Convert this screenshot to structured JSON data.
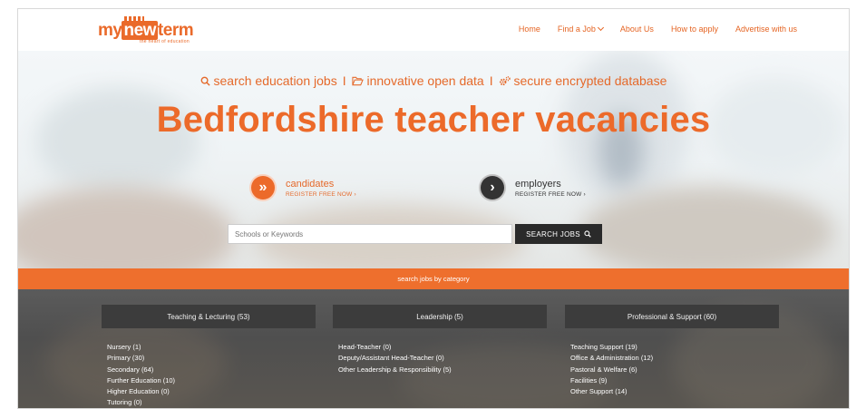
{
  "header": {
    "logo": {
      "my": "my",
      "new": "new",
      "term": "term",
      "tagline": "the heart of education"
    },
    "nav": [
      {
        "label": "Home"
      },
      {
        "label": "Find a Job"
      },
      {
        "label": "About Us"
      },
      {
        "label": "How to apply"
      },
      {
        "label": "Advertise with us"
      }
    ]
  },
  "hero": {
    "tagline": {
      "item1": "search education jobs",
      "sep": "I",
      "item2": "innovative open data",
      "item3": "secure encrypted database"
    },
    "headline": "Bedfordshire teacher vacancies",
    "candidates": {
      "title": "candidates",
      "sub": "REGISTER FREE NOW ›"
    },
    "employers": {
      "title": "employers",
      "sub": "REGISTER FREE NOW ›"
    },
    "search": {
      "placeholder": "Schools or Keywords",
      "button": "SEARCH JOBS"
    }
  },
  "categories": {
    "band_label": "search jobs by category",
    "columns": [
      {
        "title": "Teaching & Lecturing (53)",
        "items": [
          "Nursery (1)",
          "Primary (30)",
          "Secondary (64)",
          "Further Education (10)",
          "Higher Education (0)",
          "Tutoring (0)"
        ]
      },
      {
        "title": "Leadership (5)",
        "items": [
          "Head-Teacher (0)",
          "Deputy/Assistant Head-Teacher (0)",
          "Other Leadership & Responsibility (5)"
        ]
      },
      {
        "title": "Professional & Support (60)",
        "items": [
          "Teaching Support (19)",
          "Office & Administration (12)",
          "Pastoral & Welfare (6)",
          "Facilities (9)",
          "Other Support (14)"
        ]
      }
    ]
  },
  "colors": {
    "brand": "#ec6a2a",
    "dark": "#2a2a2a",
    "band": "#ee6f2d"
  }
}
